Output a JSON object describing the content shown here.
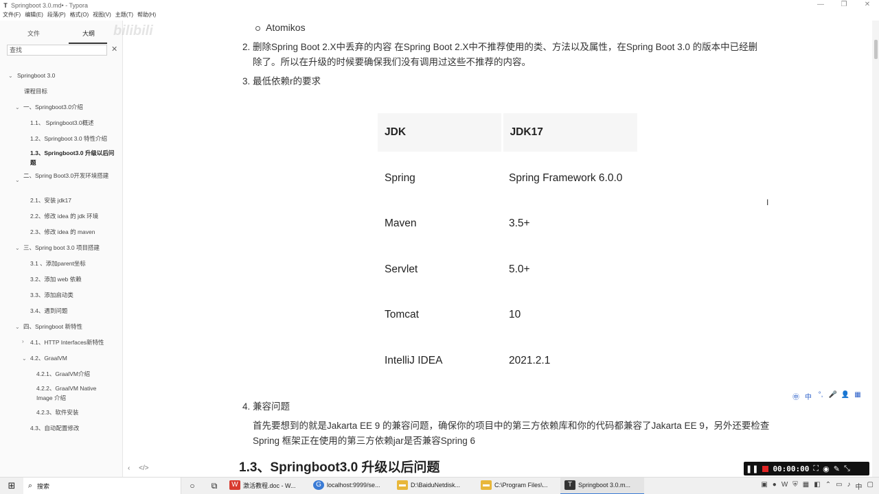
{
  "window": {
    "title": "Springboot 3.0.md• - Typora",
    "app_icon": "T",
    "controls": [
      "—",
      "❐",
      "✕"
    ]
  },
  "menu": [
    "文件(F)",
    "编辑(E)",
    "段落(P)",
    "格式(O)",
    "视图(V)",
    "主题(T)",
    "帮助(H)"
  ],
  "sidebar": {
    "tabs": {
      "files": "文件",
      "outline": "大纲"
    },
    "search_placeholder": "查找",
    "outline": [
      {
        "label": "Springboot 3.0"
      },
      {
        "label": "课程目标"
      },
      {
        "label": "一、Springboot3.0介绍"
      },
      {
        "label": "1.1、 Springboot3.0概述"
      },
      {
        "label": "1.2、Springboot 3.0 特性介绍"
      },
      {
        "label": "1.3、Springboot3.0 升级以后问题"
      },
      {
        "label": "二、Spring Boot3.0开发环境搭建"
      },
      {
        "label": "2.1、安装 jdk17"
      },
      {
        "label": "2.2、修改 idea 的 jdk 环境"
      },
      {
        "label": "2.3、修改 idea 的 maven"
      },
      {
        "label": "三、Spring boot 3.0 项目搭建"
      },
      {
        "label": "3.1 、添加parent坐标"
      },
      {
        "label": "3.2、添加 web 依赖"
      },
      {
        "label": "3.3、添加启动类"
      },
      {
        "label": "3.4、遇到问题"
      },
      {
        "label": "四、Springboot 新特性"
      },
      {
        "label": "4.1、HTTP Interfaces新特性"
      },
      {
        "label": "4.2、GraalVM"
      },
      {
        "label": "4.2.1、GraalVM介绍"
      },
      {
        "label": "4.2.2、GraalVM Native Image 介绍"
      },
      {
        "label": "4.2.3、软件安装"
      },
      {
        "label": "4.3、自动配置修改"
      }
    ],
    "bottom": [
      "‹",
      "</>"
    ]
  },
  "content": {
    "sub_bullet": "Atomikos",
    "item2_num": "2.",
    "item2_line1": "删除Spring Boot 2.X中丢弃的内容 在Spring Boot 2.X中不推荐使用的类、方法以及属性，在Spring Boot 3.0 的版本中已经删",
    "item2_line2": "除了。所以在升级的时候要确保我们没有调用过这些不推荐的内容。",
    "item3_num": "3.",
    "item3": "最低依赖r的要求",
    "table": {
      "header": [
        "JDK",
        "JDK17"
      ],
      "rows": [
        [
          "Spring",
          "Spring Framework 6.0.0"
        ],
        [
          "Maven",
          "3.5+"
        ],
        [
          "Servlet",
          "5.0+"
        ],
        [
          "Tomcat",
          "10"
        ],
        [
          "IntelliJ IDEA",
          "2021.2.1"
        ]
      ]
    },
    "item4_num": "4.",
    "item4": "兼容问题",
    "item4_line1": "首先要想到的就是Jakarta EE 9 的兼容问题，确保你的项目中的第三方依赖库和你的代码都兼容了Jakarta EE 9，另外还要检查",
    "item4_line2": "Spring 框架正在使用的第三方依赖jar是否兼容Spring 6",
    "heading": "1.3、Springboot3.0 升级以后问题"
  },
  "ime": [
    "㊥",
    "中",
    "°,",
    "🎤",
    "👤",
    "▦"
  ],
  "recorder": {
    "time": "00:00:00"
  },
  "taskbar": {
    "search": "搜索",
    "apps": [
      {
        "label": "激活教程.doc - W...",
        "color": "#d83b2f",
        "glyph": "W"
      },
      {
        "label": "localhost:9999/se...",
        "color": "#3a7bd5",
        "glyph": "G"
      },
      {
        "label": "D:\\BaiduNetdisk...",
        "color": "#e8b73a",
        "glyph": "▬"
      },
      {
        "label": "C:\\Program Files\\...",
        "color": "#e8b73a",
        "glyph": "▬"
      },
      {
        "label": "Springboot 3.0.m...",
        "color": "#333333",
        "glyph": "T"
      }
    ]
  }
}
